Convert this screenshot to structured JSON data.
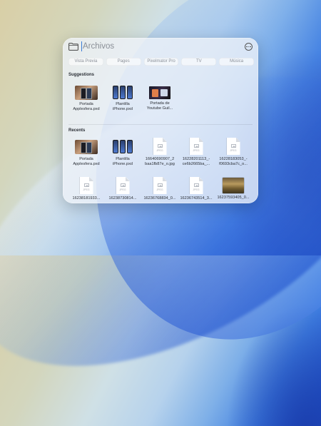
{
  "search": {
    "placeholder": "Archivos"
  },
  "chips": [
    "Vista Previa",
    "Pages",
    "Pixelmator Pro",
    "TV",
    "Música"
  ],
  "suggestions": {
    "title": "Suggestions",
    "items": [
      {
        "label": "Portada\nApplesfera.pxd",
        "kind": "photo-phones"
      },
      {
        "label": "Plantilla\niPhone.pxd",
        "kind": "phones"
      },
      {
        "label": "Portada de\nYoutube Guil...",
        "kind": "youtube"
      }
    ]
  },
  "recents": {
    "title": "Recents",
    "row1": [
      {
        "label": "Portada\nApplesfera.pxd",
        "kind": "photo-phones"
      },
      {
        "label": "Plantilla\niPhone.pxd",
        "kind": "phones"
      },
      {
        "label": "16640690907_2\nbaa1fb87e_o.jpg",
        "kind": "jpeg"
      },
      {
        "label": "16228201113_-\nce6b2665ba_...",
        "kind": "jpeg"
      },
      {
        "label": "16228183053_-\nf0693cba7c_o...",
        "kind": "jpeg"
      }
    ],
    "row2": [
      {
        "label": "16238181933...",
        "kind": "jpeg"
      },
      {
        "label": "16238730814...",
        "kind": "jpeg"
      },
      {
        "label": "16236768834_0...",
        "kind": "jpeg"
      },
      {
        "label": "16236743514_3...",
        "kind": "jpeg"
      },
      {
        "label": "16237593405_0...",
        "kind": "photo"
      }
    ]
  },
  "jpeg_ext": "JPEG"
}
